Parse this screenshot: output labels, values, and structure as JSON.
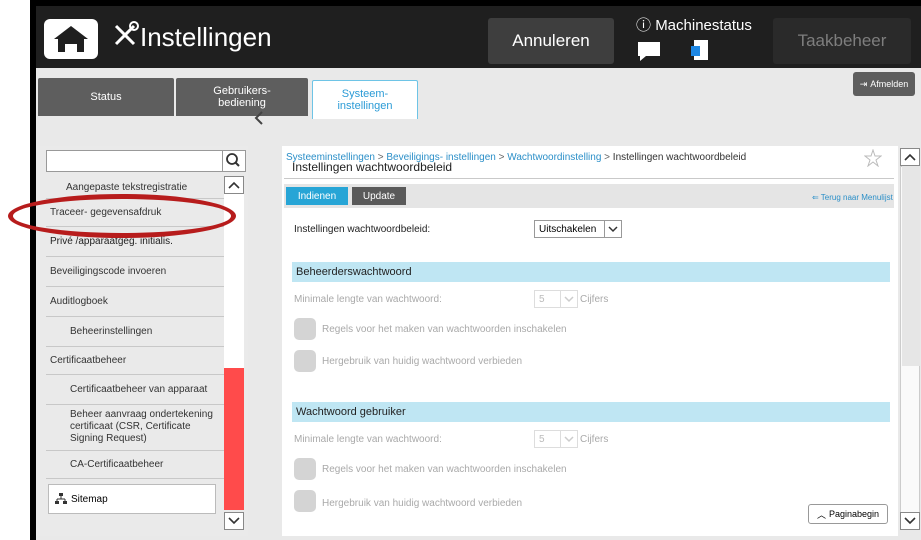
{
  "header": {
    "title": "Instellingen",
    "cancel_label": "Annuleren",
    "machine_status_label": "Machinestatus",
    "job_status_label": "Taakbeheer"
  },
  "tabs": [
    {
      "label": "Status"
    },
    {
      "label": "Gebruikers-\nbediening"
    },
    {
      "label": "Systeem-\ninstellingen"
    }
  ],
  "logout_label": "Afmelden",
  "sidebar": {
    "items": [
      {
        "label": "Aangepaste tekstregistratie"
      },
      {
        "label": "Traceer- gegevensafdruk"
      },
      {
        "label": "Privé /apparaatgeg. initialis."
      },
      {
        "label": "Beveiligingscode invoeren"
      },
      {
        "label": "Auditlogboek"
      },
      {
        "label": "Beheerinstellingen"
      },
      {
        "label": "Certificaatbeheer"
      },
      {
        "label": "Certificaatbeheer van apparaat"
      },
      {
        "label": "Beheer aanvraag ondertekening certificaat (CSR, Certificate Signing Request)"
      },
      {
        "label": "CA-Certificaatbeheer"
      }
    ],
    "sitemap_label": "Sitemap"
  },
  "breadcrumb": {
    "items": [
      "Systeeminstellingen",
      "Beveiligings- instellingen",
      "Wachtwoordinstelling"
    ],
    "separator": ">",
    "current": "Instellingen wachtwoordbeleid"
  },
  "panel": {
    "title": "Instellingen wachtwoordbeleid",
    "submit_label": "Indienen",
    "update_label": "Update",
    "back_label": "Terug naar Menulijst"
  },
  "policy": {
    "label": "Instellingen wachtwoordbeleid:",
    "value": "Uitschakelen"
  },
  "admin_section": {
    "title": "Beheerderswachtwoord",
    "min_length_label": "Minimale lengte van wachtwoord:",
    "min_length_value": "5",
    "unit": "Cijfers",
    "rules_label": "Regels voor het maken van wachtwoorden inschakelen",
    "reuse_label": "Hergebruik van huidig wachtwoord verbieden"
  },
  "user_section": {
    "title": "Wachtwoord gebruiker",
    "min_length_label": "Minimale lengte van wachtwoord:",
    "min_length_value": "5",
    "unit": "Cijfers",
    "rules_label": "Regels voor het maken van wachtwoorden inschakelen",
    "reuse_label": "Hergebruik van huidig wachtwoord verbieden"
  },
  "page_top_label": "Paginabegin",
  "colors": {
    "accent": "#27a5d6",
    "section": "#bfe6f3",
    "highlight_oval": "#b71c1c",
    "scroll_thumb": "#ff4b4b"
  }
}
